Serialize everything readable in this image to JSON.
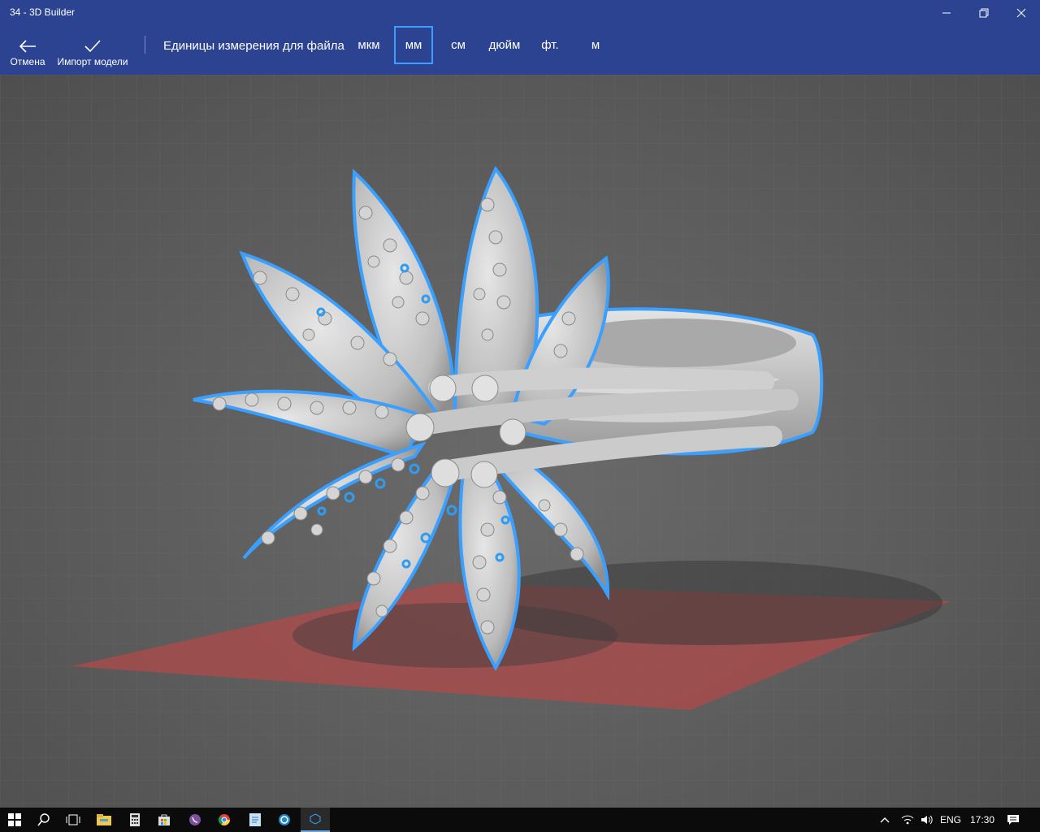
{
  "window": {
    "title": "34 - 3D Builder"
  },
  "toolbar": {
    "cancel_label": "Отмена",
    "import_label": "Импорт модели",
    "units_label": "Единицы измерения для файла",
    "units": [
      "мкм",
      "мм",
      "см",
      "дюйм",
      "фт.",
      "м"
    ],
    "selected_unit": "мм"
  },
  "colors": {
    "accent": "#2b4390",
    "selection_outline": "#3aa0ff",
    "model": "#c8c8c8",
    "base_plate": "#b04a4a"
  },
  "taskbar": {
    "apps": [
      "start-icon",
      "search-icon",
      "task-view-icon",
      "file-explorer-icon",
      "calculator-icon",
      "store-icon",
      "viber-icon",
      "chrome-icon",
      "notes-icon",
      "settings-icon",
      "3d-builder-icon"
    ],
    "language": "ENG",
    "time": "17:30"
  }
}
